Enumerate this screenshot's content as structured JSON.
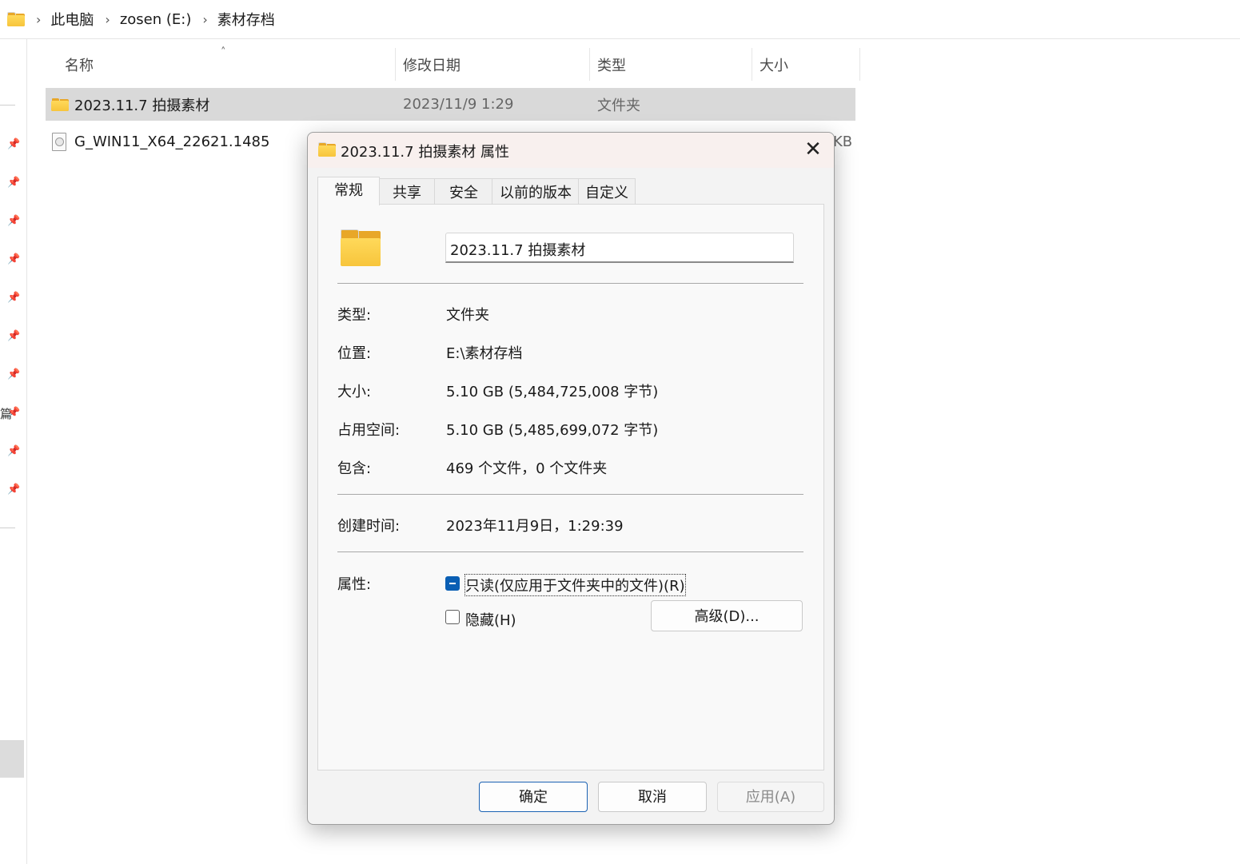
{
  "explorer": {
    "breadcrumb": [
      "此电脑",
      "zosen (E:)",
      "素材存档"
    ],
    "columns": {
      "name": "名称",
      "date": "修改日期",
      "type": "类型",
      "size": "大小"
    },
    "rows": [
      {
        "name": "2023.11.7 拍摄素材",
        "date": "2023/11/9 1:29",
        "type": "文件夹",
        "size": "",
        "icon": "folder-icon",
        "selected": true
      },
      {
        "name": "G_WIN11_X64_22621.1485",
        "date": "",
        "type": "",
        "size": "KB",
        "icon": "disc-image-icon",
        "selected": false
      }
    ],
    "nav_partial_text": "篇"
  },
  "dialog": {
    "title": "2023.11.7 拍摄素材 属性",
    "tabs": [
      "常规",
      "共享",
      "安全",
      "以前的版本",
      "自定义"
    ],
    "active_tab": "常规",
    "folder_name": "2023.11.7 拍摄素材",
    "props": {
      "type_label": "类型:",
      "type_value": "文件夹",
      "location_label": "位置:",
      "location_value": "E:\\素材存档",
      "size_label": "大小:",
      "size_value": "5.10 GB (5,484,725,008 字节)",
      "disk_label": "占用空间:",
      "disk_value": "5.10 GB (5,485,699,072 字节)",
      "contains_label": "包含:",
      "contains_value": "469 个文件，0 个文件夹",
      "created_label": "创建时间:",
      "created_value": "2023年11月9日，1:29:39",
      "attributes_label": "属性:"
    },
    "readonly_label": "只读(仅应用于文件夹中的文件)(R)",
    "readonly_state": "indeterminate",
    "hidden_label": "隐藏(H)",
    "hidden_checked": false,
    "advanced_button": "高级(D)...",
    "ok_button": "确定",
    "cancel_button": "取消",
    "apply_button": "应用(A)",
    "close_glyph": "✕"
  },
  "colors": {
    "accent": "#0a5fb4",
    "folder_yellow": "#f7c53c",
    "selection": "#d9d9d9"
  }
}
